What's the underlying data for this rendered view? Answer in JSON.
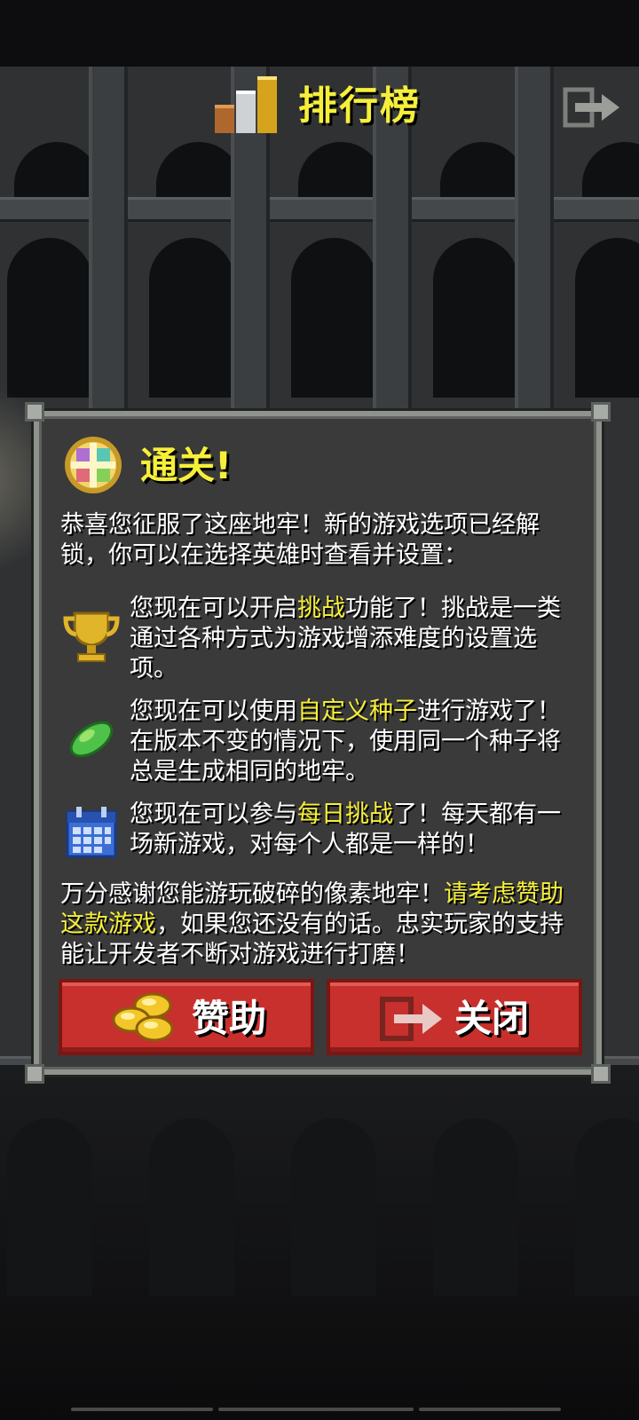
{
  "header": {
    "title": "排行榜",
    "icon": "leaderboard-icon",
    "exit_icon": "exit-icon"
  },
  "dialog": {
    "title": "通关!",
    "title_icon": "amulet-icon",
    "intro": "恭喜您征服了这座地牢！新的游戏选项已经解锁，你可以在选择英雄时查看并设置：",
    "features": [
      {
        "icon": "trophy-icon",
        "before": "您现在可以开启",
        "highlight": "挑战",
        "after": "功能了！挑战是一类通过各种方式为游戏增添难度的设置选项。"
      },
      {
        "icon": "seed-icon",
        "before": "您现在可以使用",
        "highlight": "自定义种子",
        "after": "进行游戏了！在版本不变的情况下，使用同一个种子将总是生成相同的地牢。"
      },
      {
        "icon": "calendar-icon",
        "before": "您现在可以参与",
        "highlight": "每日挑战",
        "after": "了！每天都有一场新游戏，对每个人都是一样的！"
      }
    ],
    "thanks": {
      "before": "万分感谢您能游玩破碎的像素地牢！",
      "highlight": "请考虑赞助这款游戏",
      "after": "，如果您还没有的话。忠实玩家的支持能让开发者不断对游戏进行打磨！"
    },
    "buttons": {
      "donate_label": "赞助",
      "donate_icon": "gold-coins-icon",
      "close_label": "关闭",
      "close_icon": "exit-icon"
    }
  },
  "colors": {
    "highlight": "#f6ef3a",
    "button": "#c7302c",
    "panel": "#3a3a3a"
  }
}
